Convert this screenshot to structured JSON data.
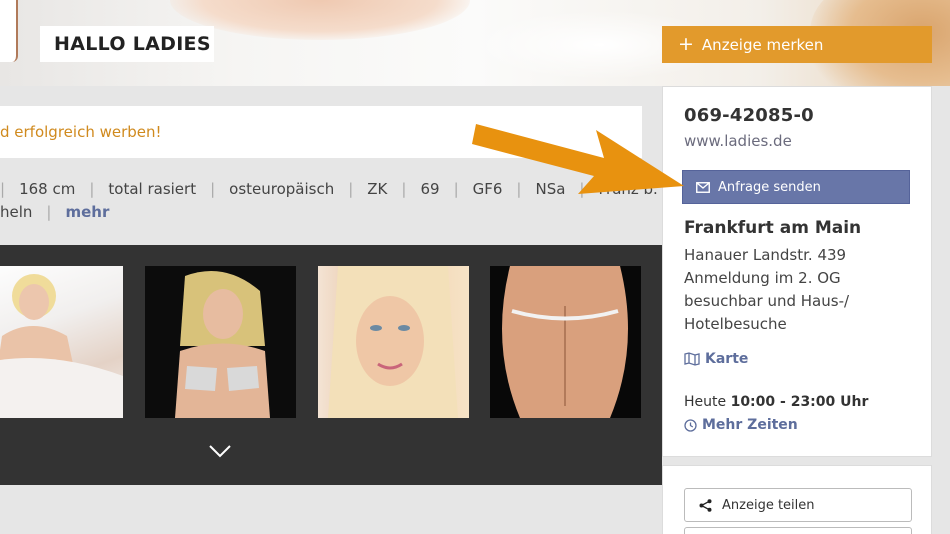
{
  "header": {
    "title": "HALLO LADIES",
    "bookmark_label": "Anzeige merken"
  },
  "notice": {
    "text": "d erfolgreich werben!"
  },
  "attributes": {
    "row1": [
      "168 cm",
      "total rasiert",
      "osteuropäisch",
      "ZK",
      "69",
      "GF6",
      "NSa",
      "Franz b."
    ],
    "row2_text": "heln",
    "more_label": "mehr"
  },
  "sidebar": {
    "phone": "069-42085-0",
    "website": "www.ladies.de",
    "inquiry_label": "Anfrage senden",
    "city": "Frankfurt am Main",
    "address_lines": [
      "Hanauer Landstr. 439",
      "Anmeldung im 2. OG",
      "besuchbar und Haus-/",
      "Hotelbesuche"
    ],
    "map_label": "Karte",
    "hours_prefix": "Heute",
    "hours_value": "10:00 - 23:00 Uhr",
    "more_times_label": "Mehr Zeiten",
    "share_label": "Anzeige teilen"
  },
  "colors": {
    "accent_orange": "#e29a2c",
    "inquiry_blue": "#6876a8",
    "link_blue": "#5e6e9c",
    "gallery_bg": "#333333"
  },
  "icons": {
    "bookmark": "plus-icon",
    "inquiry": "envelope-icon",
    "map": "map-icon",
    "times": "clock-icon",
    "share": "share-icon",
    "gallery_more": "chevron-down-icon"
  }
}
